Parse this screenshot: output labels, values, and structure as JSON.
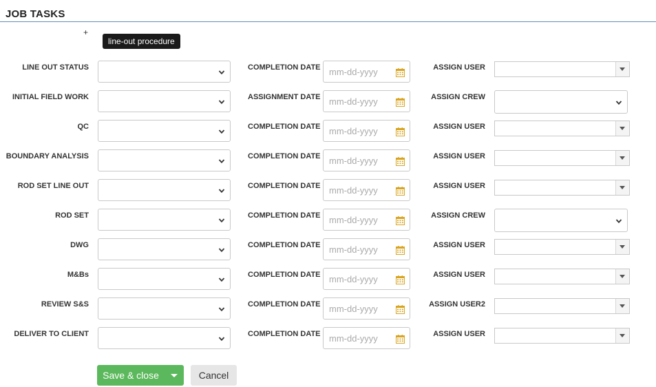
{
  "section": {
    "title": "JOB TASKS",
    "add_symbol": "+"
  },
  "tooltip": {
    "text": "line-out procedure"
  },
  "date_placeholder": "mm-dd-yyyy",
  "colors": {
    "accent_rule": "#5a8fb8",
    "save": "#5cb85c",
    "calendar": "#d9a520"
  },
  "tasks": [
    {
      "label": "LINE OUT STATUS",
      "date_label": "COMPLETION DATE",
      "assign_label": "ASSIGN USER",
      "assign_type": "user"
    },
    {
      "label": "INITIAL FIELD WORK",
      "date_label": "ASSIGNMENT DATE",
      "assign_label": "ASSIGN CREW",
      "assign_type": "crew"
    },
    {
      "label": "QC",
      "date_label": "COMPLETION DATE",
      "assign_label": "ASSIGN USER",
      "assign_type": "user"
    },
    {
      "label": "BOUNDARY ANALYSIS",
      "date_label": "COMPLETION DATE",
      "assign_label": "ASSIGN USER",
      "assign_type": "user"
    },
    {
      "label": "ROD SET LINE OUT",
      "date_label": "COMPLETION DATE",
      "assign_label": "ASSIGN USER",
      "assign_type": "user"
    },
    {
      "label": "ROD SET",
      "date_label": "COMPLETION DATE",
      "assign_label": "ASSIGN CREW",
      "assign_type": "crew"
    },
    {
      "label": "DWG",
      "date_label": "COMPLETION DATE",
      "assign_label": "ASSIGN USER",
      "assign_type": "user"
    },
    {
      "label": "M&Bs",
      "date_label": "COMPLETION DATE",
      "assign_label": "ASSIGN USER",
      "assign_type": "user"
    },
    {
      "label": "REVIEW S&S",
      "date_label": "COMPLETION DATE",
      "assign_label": "ASSIGN USER2",
      "assign_type": "user"
    },
    {
      "label": "DELIVER TO CLIENT",
      "date_label": "COMPLETION DATE",
      "assign_label": "ASSIGN USER",
      "assign_type": "user"
    }
  ],
  "buttons": {
    "save": "Save & close",
    "cancel": "Cancel"
  }
}
